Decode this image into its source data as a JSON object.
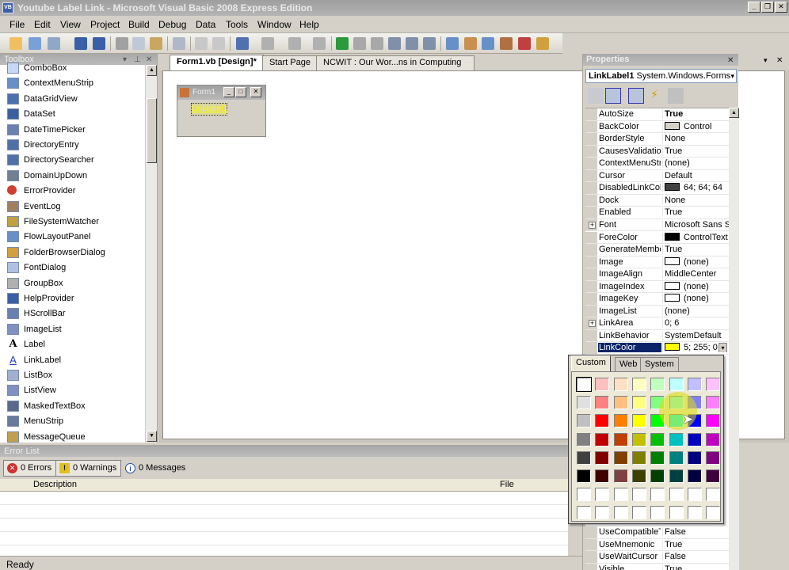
{
  "window": {
    "title": "Youtube Label Link - Microsoft Visual Basic 2008 Express Edition",
    "app_icon": "vb-icon"
  },
  "menubar": {
    "items": [
      "File",
      "Edit",
      "View",
      "Project",
      "Build",
      "Debug",
      "Data",
      "Tools",
      "Window",
      "Help"
    ]
  },
  "toolbox": {
    "title": "Toolbox",
    "items": [
      {
        "label": "ComboBox",
        "icon": "combobox-icon"
      },
      {
        "label": "ContextMenuStrip",
        "icon": "contextmenustrip-icon"
      },
      {
        "label": "DataGridView",
        "icon": "datagridview-icon"
      },
      {
        "label": "DataSet",
        "icon": "dataset-icon"
      },
      {
        "label": "DateTimePicker",
        "icon": "datetimepicker-icon"
      },
      {
        "label": "DirectoryEntry",
        "icon": "directoryentry-icon"
      },
      {
        "label": "DirectorySearcher",
        "icon": "directorysearcher-icon"
      },
      {
        "label": "DomainUpDown",
        "icon": "domainupdown-icon"
      },
      {
        "label": "ErrorProvider",
        "icon": "errorprovider-icon"
      },
      {
        "label": "EventLog",
        "icon": "eventlog-icon"
      },
      {
        "label": "FileSystemWatcher",
        "icon": "filesystemwatcher-icon"
      },
      {
        "label": "FlowLayoutPanel",
        "icon": "flowlayoutpanel-icon"
      },
      {
        "label": "FolderBrowserDialog",
        "icon": "folderbrowserdialog-icon"
      },
      {
        "label": "FontDialog",
        "icon": "fontdialog-icon"
      },
      {
        "label": "GroupBox",
        "icon": "groupbox-icon"
      },
      {
        "label": "HelpProvider",
        "icon": "helpprovider-icon"
      },
      {
        "label": "HScrollBar",
        "icon": "hscrollbar-icon"
      },
      {
        "label": "ImageList",
        "icon": "imagelist-icon"
      },
      {
        "label": "Label",
        "icon": "label-icon"
      },
      {
        "label": "LinkLabel",
        "icon": "linklabel-icon"
      },
      {
        "label": "ListBox",
        "icon": "listbox-icon"
      },
      {
        "label": "ListView",
        "icon": "listview-icon"
      },
      {
        "label": "MaskedTextBox",
        "icon": "maskedtextbox-icon"
      },
      {
        "label": "MenuStrip",
        "icon": "menustrip-icon"
      },
      {
        "label": "MessageQueue",
        "icon": "messagequeue-icon"
      }
    ]
  },
  "documents": {
    "tabs": [
      {
        "label": "Form1.vb [Design]*",
        "active": true
      },
      {
        "label": "Start Page",
        "active": false
      },
      {
        "label": "NCWIT : Our Wor...ns in Computing",
        "active": false
      }
    ]
  },
  "designer": {
    "form_title": "Form1",
    "link_label_text": "Linklabel1"
  },
  "properties": {
    "title": "Properties",
    "selected_object": "LinkLabel1",
    "selected_type": "System.Windows.Forms",
    "rows": [
      {
        "name": "AutoSize",
        "value": "True",
        "bold": true
      },
      {
        "name": "BackColor",
        "value": "Control",
        "swatch": "#d4d0c8"
      },
      {
        "name": "BorderStyle",
        "value": "None"
      },
      {
        "name": "CausesValidation",
        "value": "True"
      },
      {
        "name": "ContextMenuStrip",
        "value": "(none)"
      },
      {
        "name": "Cursor",
        "value": "Default"
      },
      {
        "name": "DisabledLinkColor",
        "value": "64; 64; 64",
        "swatch": "#404040"
      },
      {
        "name": "Dock",
        "value": "None"
      },
      {
        "name": "Enabled",
        "value": "True"
      },
      {
        "name": "Font",
        "value": "Microsoft Sans Serif",
        "expandable": true
      },
      {
        "name": "ForeColor",
        "value": "ControlText",
        "swatch": "#000000"
      },
      {
        "name": "GenerateMember",
        "value": "True"
      },
      {
        "name": "Image",
        "value": "(none)",
        "swatch": "#ffffff"
      },
      {
        "name": "ImageAlign",
        "value": "MiddleCenter"
      },
      {
        "name": "ImageIndex",
        "value": "(none)",
        "swatch": "#ffffff"
      },
      {
        "name": "ImageKey",
        "value": "(none)",
        "swatch": "#ffffff"
      },
      {
        "name": "ImageList",
        "value": "(none)"
      },
      {
        "name": "LinkArea",
        "value": "0; 6",
        "expandable": true
      },
      {
        "name": "LinkBehavior",
        "value": "SystemDefault"
      },
      {
        "name": "LinkColor",
        "value": "5; 255; 0",
        "swatch": "#ffff00",
        "selected": true
      }
    ],
    "lower_rows": [
      {
        "name": "UseCompatibleTextRendering",
        "value": "False"
      },
      {
        "name": "UseMnemonic",
        "value": "True"
      },
      {
        "name": "UseWaitCursor",
        "value": "False"
      },
      {
        "name": "Visible",
        "value": "True"
      }
    ]
  },
  "color_picker": {
    "tabs": [
      "Custom",
      "Web",
      "System"
    ],
    "active_tab": "Custom",
    "colors": [
      [
        "#ffffff",
        "#ffc0c0",
        "#ffe0c0",
        "#ffffc0",
        "#c0ffc0",
        "#c0ffff",
        "#c0c0ff",
        "#ffc0ff"
      ],
      [
        "#e0e0e0",
        "#ff8080",
        "#ffc080",
        "#ffff80",
        "#80ff80",
        "#80ffff",
        "#8080ff",
        "#ff80ff"
      ],
      [
        "#c0c0c0",
        "#ff0000",
        "#ff8000",
        "#ffff00",
        "#00ff00",
        "#00ffff",
        "#0000ff",
        "#ff00ff"
      ],
      [
        "#808080",
        "#c00000",
        "#c04000",
        "#c0c000",
        "#00c000",
        "#00c0c0",
        "#0000c0",
        "#c000c0"
      ],
      [
        "#404040",
        "#800000",
        "#804000",
        "#808000",
        "#008000",
        "#008080",
        "#000080",
        "#800080"
      ],
      [
        "#000000",
        "#400000",
        "#804040",
        "#404000",
        "#004000",
        "#004040",
        "#000040",
        "#400040"
      ],
      [
        "#ffffff",
        "#ffffff",
        "#ffffff",
        "#ffffff",
        "#ffffff",
        "#ffffff",
        "#ffffff",
        "#ffffff"
      ],
      [
        "#ffffff",
        "#ffffff",
        "#ffffff",
        "#ffffff",
        "#ffffff",
        "#ffffff",
        "#ffffff",
        "#ffffff"
      ]
    ]
  },
  "error_list": {
    "title": "Error List",
    "errors_label": "0 Errors",
    "warnings_label": "0 Warnings",
    "messages_label": "0 Messages",
    "columns": [
      "Description",
      "File"
    ]
  },
  "status": {
    "text": "Ready"
  }
}
